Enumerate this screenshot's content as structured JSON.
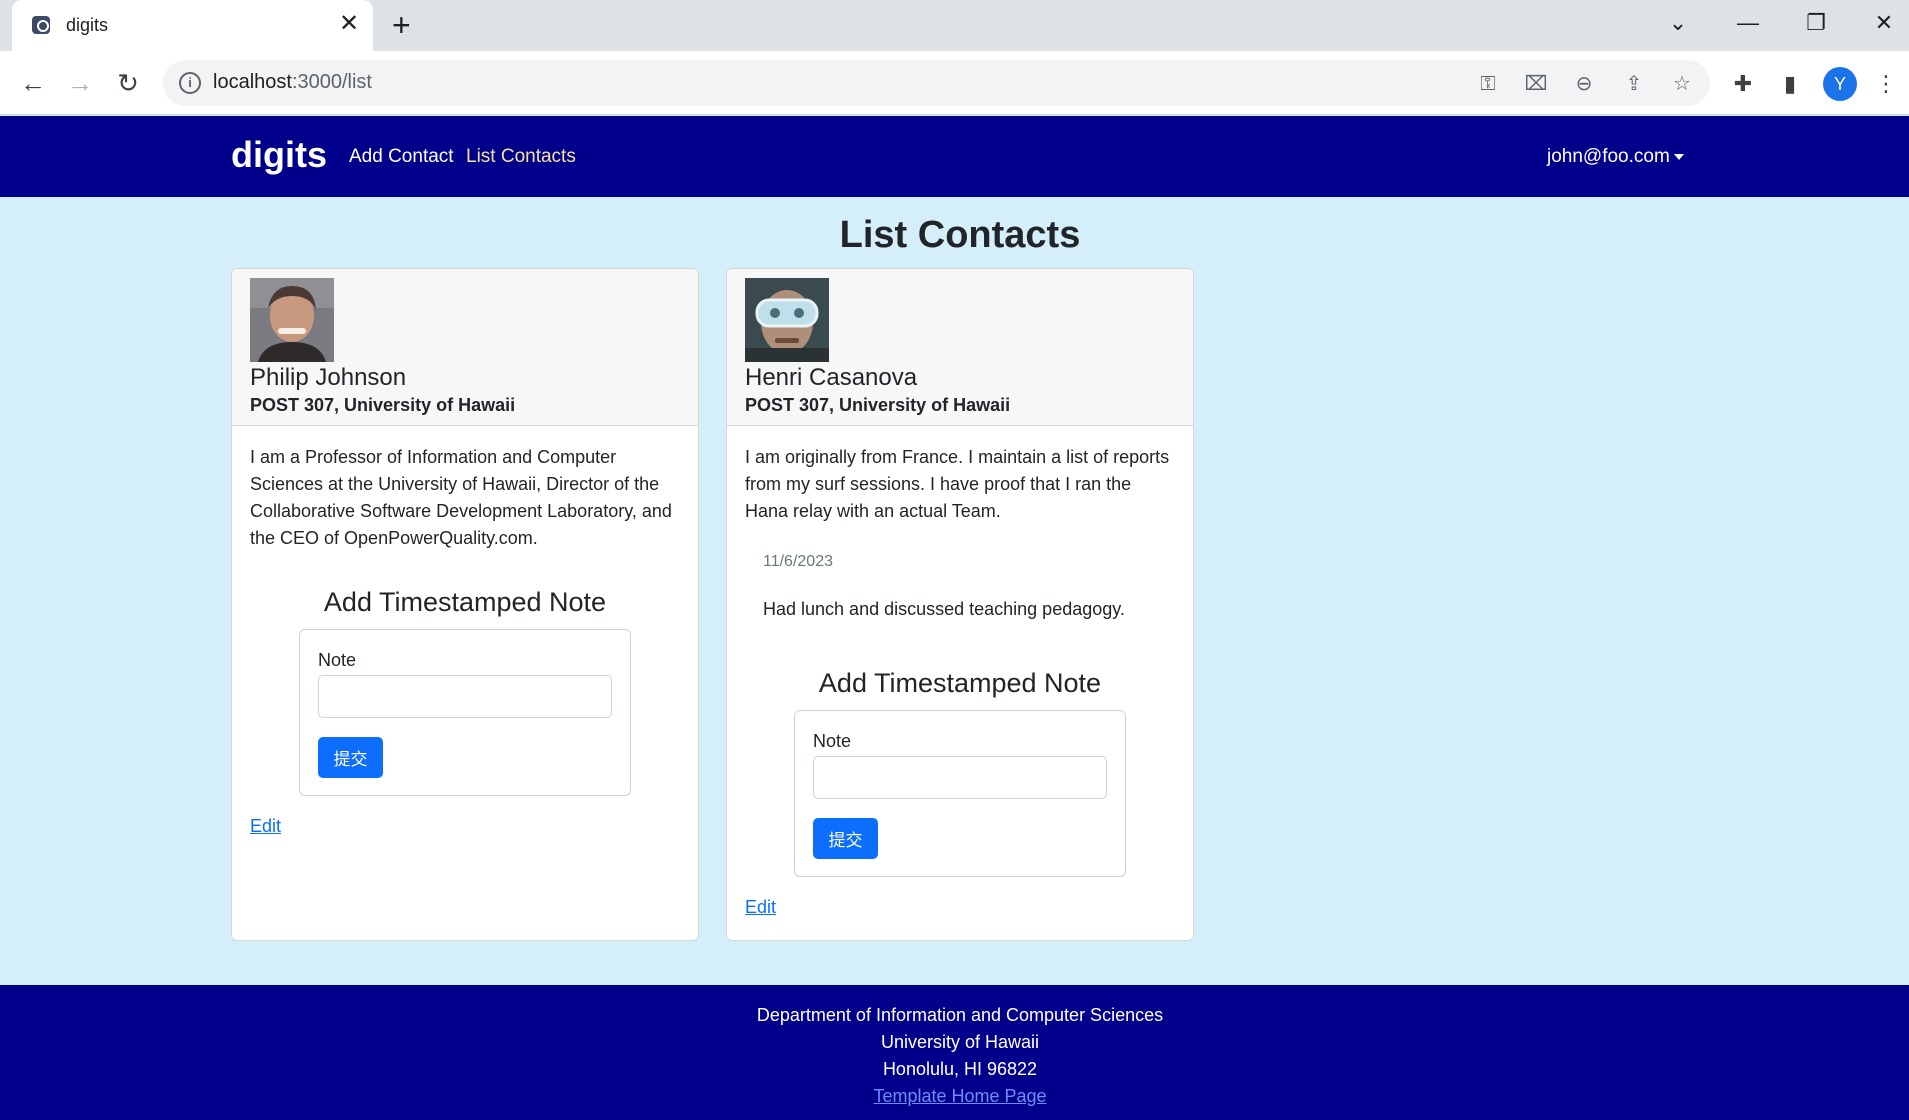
{
  "browser": {
    "tab_title": "digits",
    "url_host": "localhost",
    "url_path": ":3000/list",
    "profile_initial": "Y"
  },
  "navbar": {
    "brand": "digits",
    "links": [
      "Add Contact",
      "List Contacts"
    ],
    "active": "List Contacts",
    "user": "john@foo.com"
  },
  "page": {
    "title": "List Contacts"
  },
  "contacts": [
    {
      "name": "Philip Johnson",
      "address": "POST 307, University of Hawaii",
      "description": "I am a Professor of Information and Computer Sciences at the University of Hawaii, Director of the Collaborative Software Development Laboratory, and the CEO of OpenPowerQuality.com.",
      "notes": [],
      "form_title": "Add Timestamped Note",
      "note_label": "Note",
      "submit_label": "提交",
      "edit_label": "Edit"
    },
    {
      "name": "Henri Casanova",
      "address": "POST 307, University of Hawaii",
      "description": "I am originally from France. I maintain a list of reports from my surf sessions. I have proof that I ran the Hana relay with an actual Team.",
      "notes": [
        {
          "date": "11/6/2023",
          "text": "Had lunch and discussed teaching pedagogy."
        }
      ],
      "form_title": "Add Timestamped Note",
      "note_label": "Note",
      "submit_label": "提交",
      "edit_label": "Edit"
    }
  ],
  "footer": {
    "line1": "Department of Information and Computer Sciences",
    "line2": "University of Hawaii",
    "line3": "Honolulu, HI 96822",
    "link": "Template Home Page"
  },
  "colors": {
    "navbar_bg": "#00008b",
    "page_bg": "#d4eefa",
    "primary": "#0d6efd"
  }
}
